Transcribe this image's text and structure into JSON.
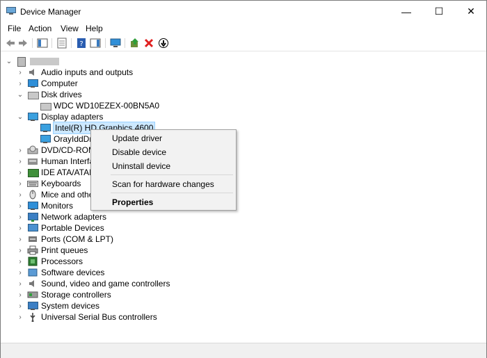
{
  "window": {
    "title": "Device Manager",
    "controls": {
      "minimize": "—",
      "maximize": "☐",
      "close": "✕"
    }
  },
  "menu": [
    "File",
    "Action",
    "View",
    "Help"
  ],
  "tree": {
    "root_label": "",
    "items": [
      {
        "label": "Audio inputs and outputs",
        "icon": "speaker-icon",
        "expanded": false
      },
      {
        "label": "Computer",
        "icon": "computer-icon",
        "expanded": false
      },
      {
        "label": "Disk drives",
        "icon": "disk-drive-icon",
        "expanded": true
      },
      {
        "label": "WDC WD10EZEX-00BN5A0",
        "icon": "disk-drive-icon",
        "child": true
      },
      {
        "label": "Display adapters",
        "icon": "display-adapter-icon",
        "expanded": true
      },
      {
        "label": "Intel(R) HD Graphics 4600",
        "icon": "display-adapter-icon",
        "child": true,
        "selected": true
      },
      {
        "label": "OrayIddDriv",
        "icon": "display-adapter-icon",
        "child": true
      },
      {
        "label": "DVD/CD-ROM",
        "icon": "dvd-icon",
        "expanded": false
      },
      {
        "label": "Human Interfa",
        "icon": "hid-icon",
        "expanded": false
      },
      {
        "label": "IDE ATA/ATAPI",
        "icon": "ide-icon",
        "expanded": false
      },
      {
        "label": "Keyboards",
        "icon": "keyboard-icon",
        "expanded": false
      },
      {
        "label": "Mice and other",
        "icon": "mouse-icon",
        "expanded": false
      },
      {
        "label": "Monitors",
        "icon": "monitor-icon",
        "expanded": false
      },
      {
        "label": "Network adapters",
        "icon": "network-adapter-icon",
        "expanded": false
      },
      {
        "label": "Portable Devices",
        "icon": "portable-device-icon",
        "expanded": false
      },
      {
        "label": "Ports (COM & LPT)",
        "icon": "port-icon",
        "expanded": false
      },
      {
        "label": "Print queues",
        "icon": "printer-icon",
        "expanded": false
      },
      {
        "label": "Processors",
        "icon": "processor-icon",
        "expanded": false
      },
      {
        "label": "Software devices",
        "icon": "software-device-icon",
        "expanded": false
      },
      {
        "label": "Sound, video and game controllers",
        "icon": "sound-icon",
        "expanded": false
      },
      {
        "label": "Storage controllers",
        "icon": "storage-controller-icon",
        "expanded": false
      },
      {
        "label": "System devices",
        "icon": "system-device-icon",
        "expanded": false
      },
      {
        "label": "Universal Serial Bus controllers",
        "icon": "usb-icon",
        "expanded": false
      }
    ]
  },
  "context_menu": {
    "update": "Update driver",
    "disable": "Disable device",
    "uninstall": "Uninstall device",
    "scan": "Scan for hardware changes",
    "properties": "Properties"
  },
  "colors": {
    "selection": "#cce8ff",
    "accent": "#0078d7"
  }
}
